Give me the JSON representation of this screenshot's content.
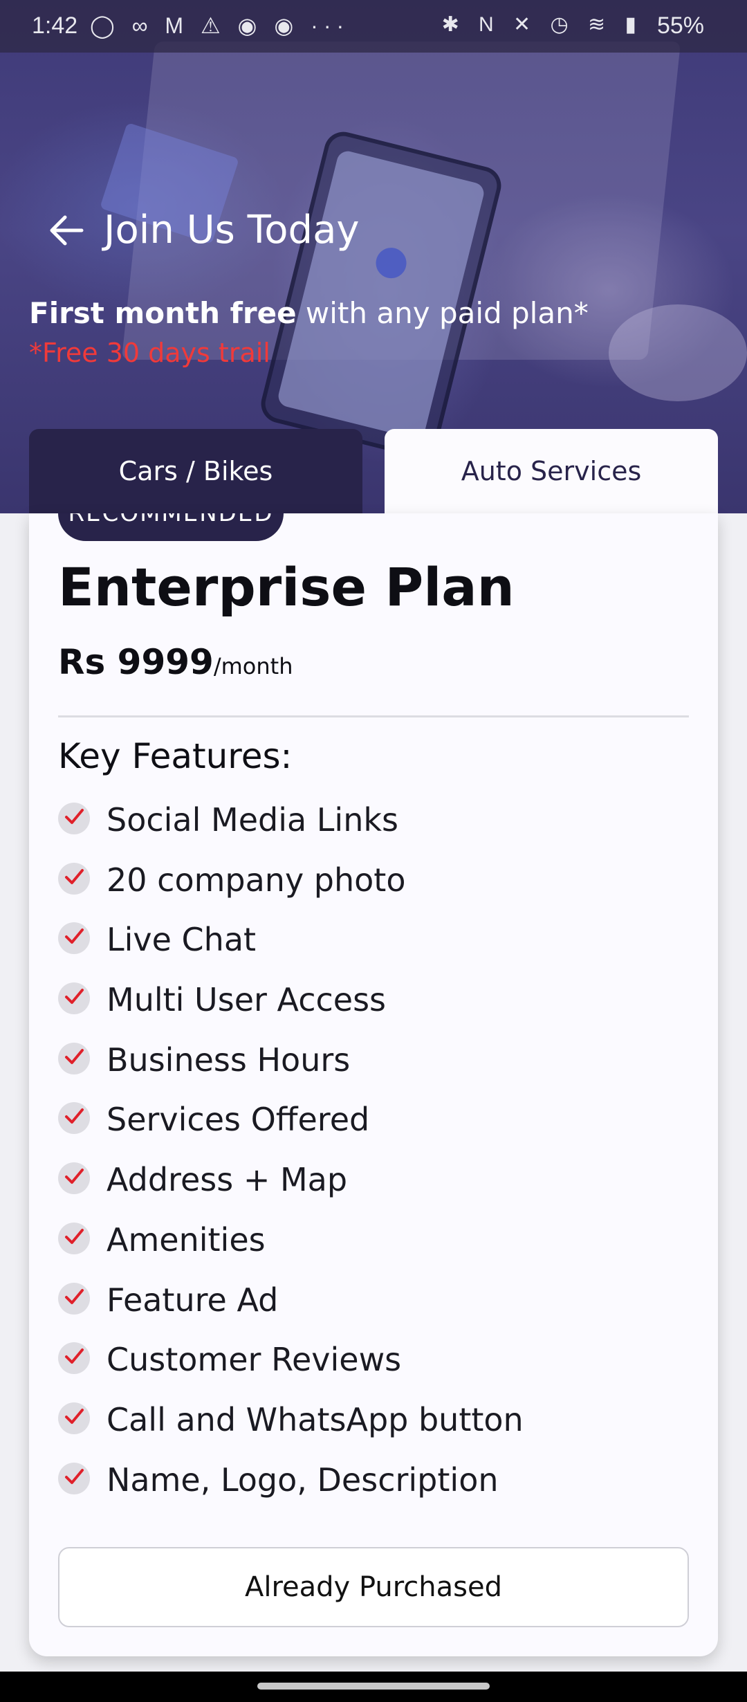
{
  "status_bar": {
    "time": "1:42",
    "left_icons": "◯ ∞ M ⚠ ◉ ◉ ···",
    "right_icons": "✱ N ✕ ◷ ≋ ▮",
    "battery": "55%"
  },
  "header": {
    "title": "Join Us Today",
    "promo_bold": "First month free",
    "promo_rest": " with any paid plan*",
    "trial_note": "*Free 30 days trail",
    "back_icon": "arrow-left-icon"
  },
  "tabs": [
    {
      "label": "Cars / Bikes",
      "active": false
    },
    {
      "label": "Auto Services",
      "active": true
    }
  ],
  "plan": {
    "badge": "RECOMMENDED",
    "name": "Enterprise Plan",
    "price": "Rs 9999",
    "period": "/month",
    "features_title": "Key Features:",
    "features": [
      "Social Media Links",
      "20 company photo",
      "Live Chat",
      "Multi User Access",
      "Business Hours",
      "Services Offered",
      "Address + Map",
      "Amenities",
      "Feature Ad",
      "Customer Reviews",
      "Call and WhatsApp button",
      "Name, Logo, Description"
    ],
    "button_label": "Already Purchased"
  },
  "colors": {
    "primary_dark": "#28234a",
    "accent_red": "#f03a3a",
    "check_red": "#e0202a"
  }
}
